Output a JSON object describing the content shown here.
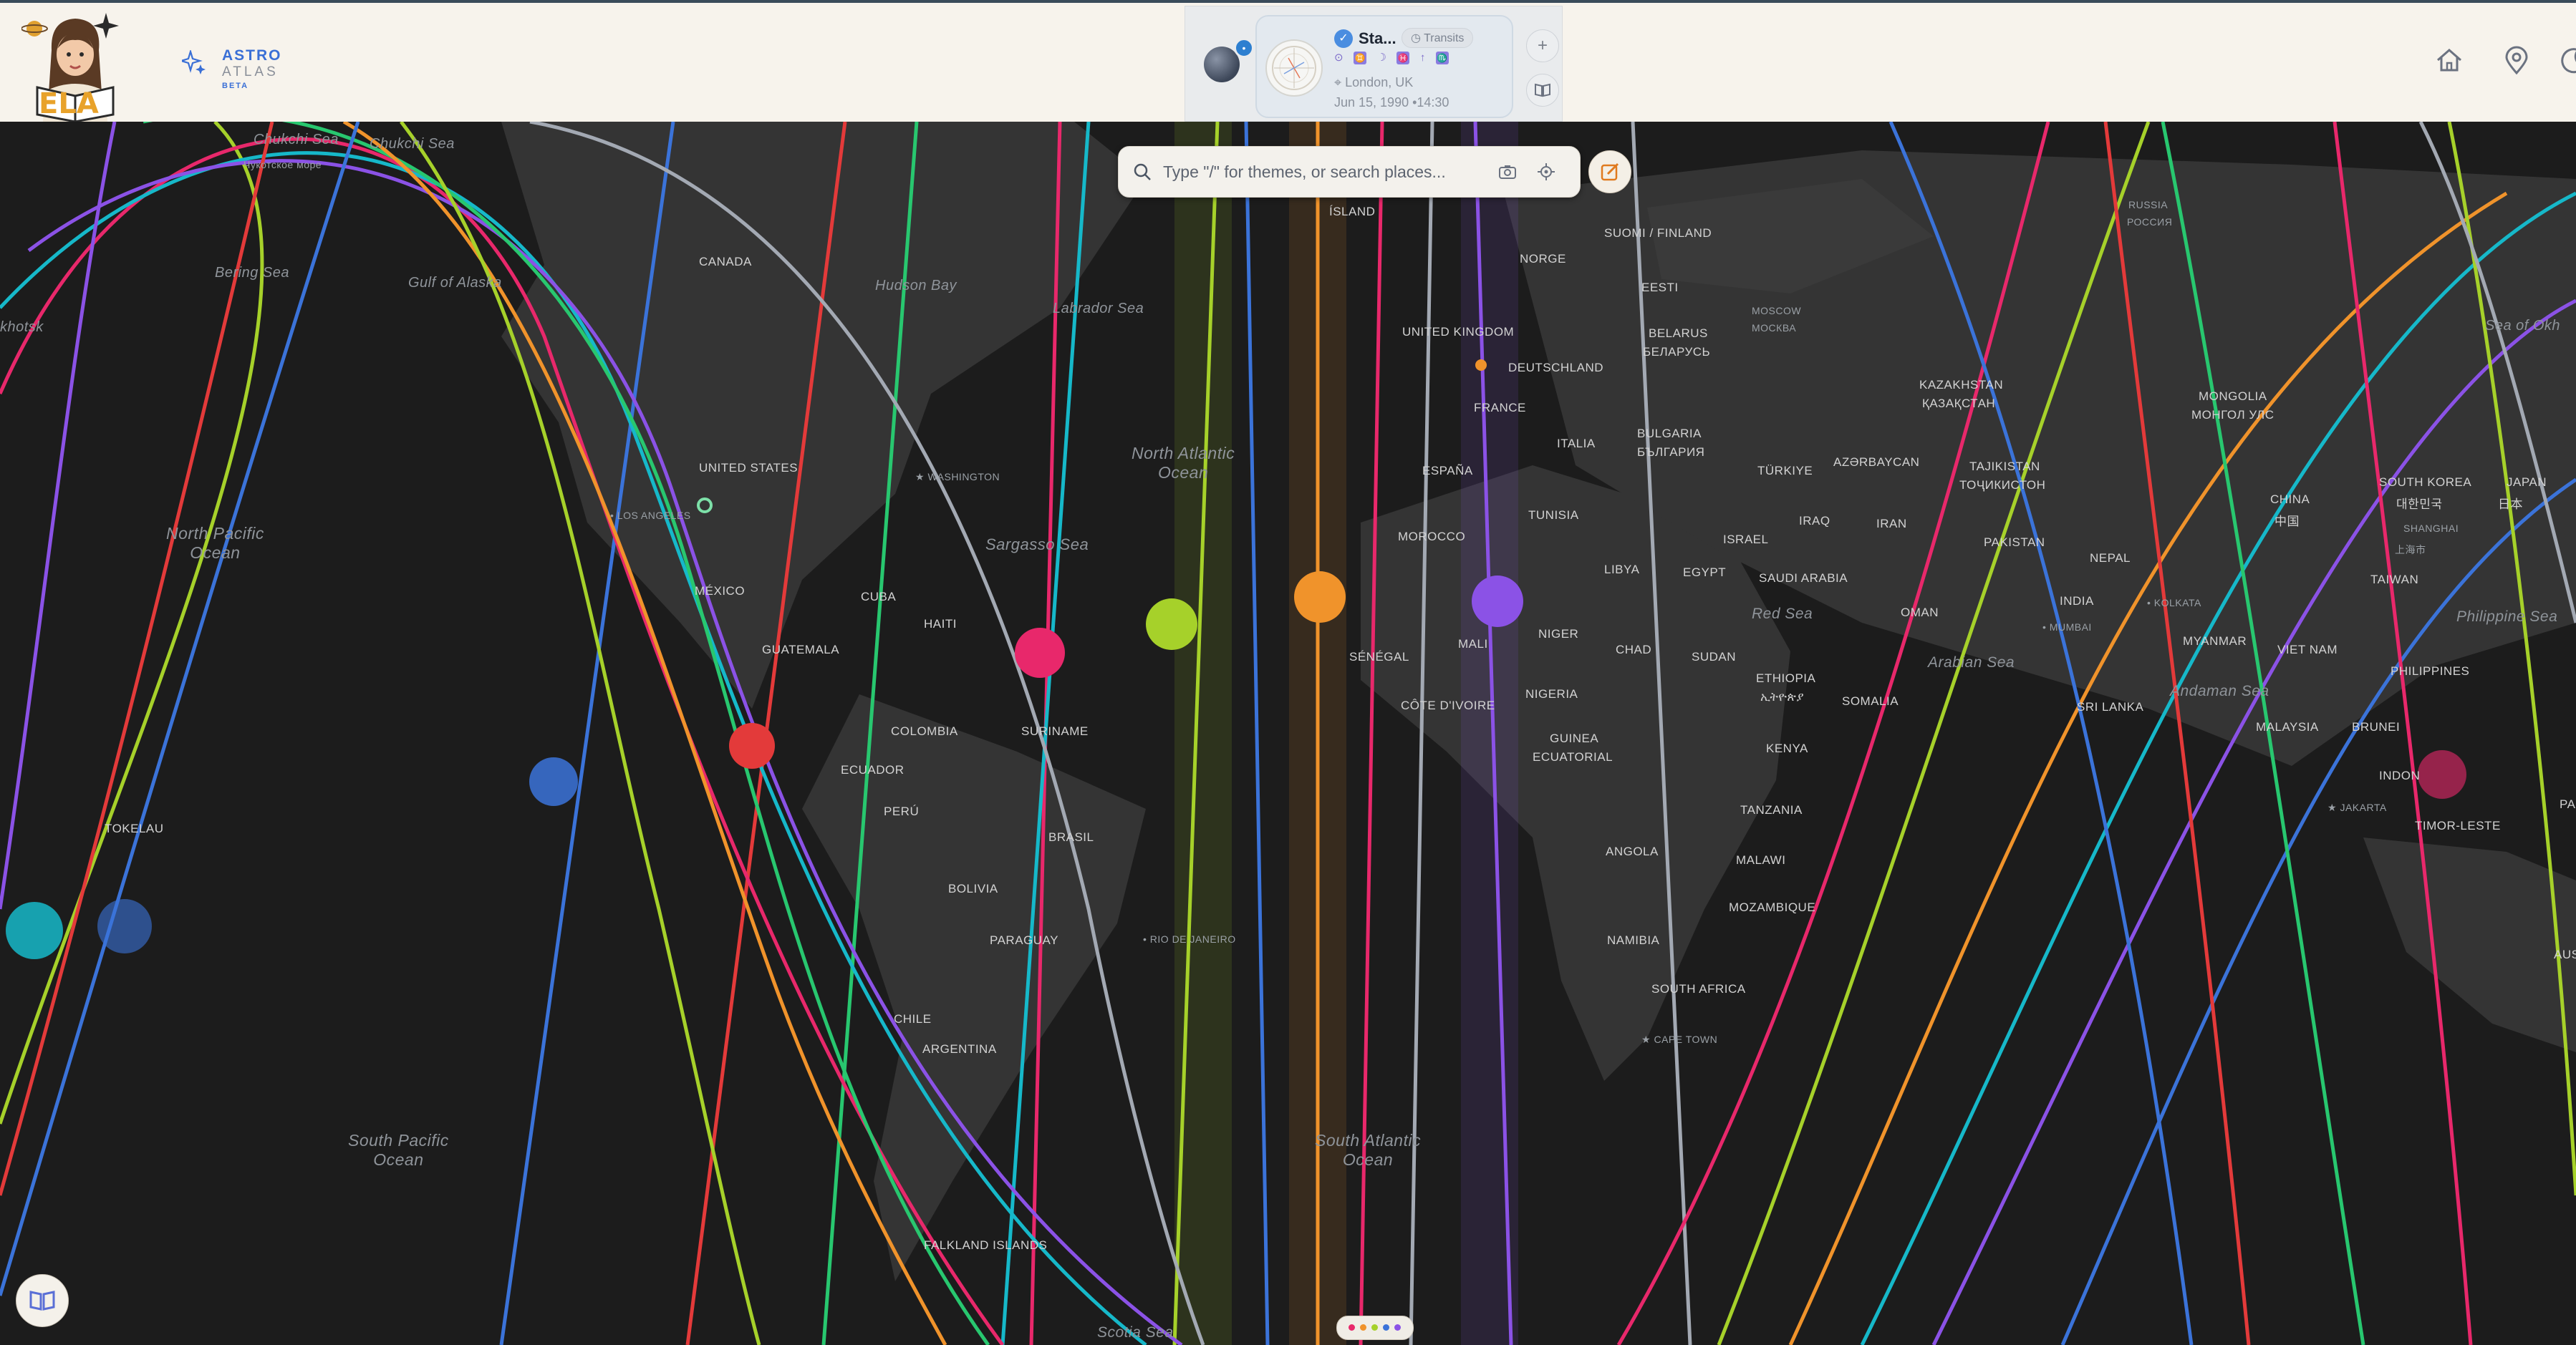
{
  "app": {
    "name_line1": "ASTRO",
    "name_line2": "ATLAS",
    "name_line3": "BETA",
    "logo_text": "ELA"
  },
  "chart_card": {
    "title": "Sta...",
    "mode_label": "Transits",
    "location": "London, UK",
    "datetime": "Jun 15, 1990 •14:30"
  },
  "side_buttons": {
    "add_label": "+"
  },
  "search": {
    "placeholder": "Type \"/\" for themes, or search places..."
  },
  "colors": {
    "header_bg": "#f7f3ec",
    "map_bg": "#1c1c1c",
    "brand_blue": "#3a6fd6",
    "line_colors": [
      "#a6d12a",
      "#f0932b",
      "#e8286b",
      "#3b73d9",
      "#8b52e6",
      "#16b8c9",
      "#e33a3a",
      "#28c76f",
      "#a3a9b3"
    ]
  },
  "icons": [
    "home-icon",
    "map-pin-icon",
    "moon-icon",
    "search-icon",
    "camera-icon",
    "locate-icon",
    "edit-icon",
    "book-icon",
    "check-icon"
  ],
  "map": {
    "labels": {
      "chukchi1": "Chukchi Sea",
      "chukchi_ru": "Чукотское море",
      "chukchi2": "Chukchi Sea",
      "bering": "Bering Sea",
      "alaska": "Gulf of Alaska",
      "okhotsk": "khotsk",
      "canada": "CANADA",
      "hudson": "Hudson Bay",
      "labrador": "Labrador Sea",
      "island": "ÍSLAND",
      "finland": "SUOMI / FINLAND",
      "russia": "RUSSIA",
      "russia_ru": "РОССИЯ",
      "norge": "NORGE",
      "eesti": "EESTI",
      "moscow": "MOSCOW",
      "moscow_ru": "МОСКВА",
      "uk": "UNITED KINGDOM",
      "belarus": "BELARUS",
      "belarus_ru": "БЕЛАРУСЬ",
      "deutschland": "DEUTSCHLAND",
      "kazakhstan": "KAZAKHSTAN",
      "kazakhstan_kz": "ҚАЗАҚСТАН",
      "mongolia": "MONGOLIA",
      "mongolia_mn": "МОНГОЛ УЛС",
      "sea_okhotsk_r": "Sea of Okh",
      "france": "FRANCE",
      "italia": "ITALIA",
      "bulgaria": "BULGARIA",
      "bulgaria_bg": "БЪЛГАРИЯ",
      "turkiye": "TÜRKIYE",
      "azerbaycan": "AZƏRBAYCAN",
      "tajikistan": "TAJIKISTAN",
      "tajikistan_tj": "ТОҶИКИСТОН",
      "us": "UNITED STATES",
      "washington": "WASHINGTON",
      "north_atlantic": "North Atlantic\nOcean",
      "espana": "ESPAÑA",
      "china": "CHINA",
      "china_zh": "中国",
      "south_korea": "SOUTH KOREA",
      "south_korea_ko": "대한민국",
      "japan": "JAPAN",
      "japan_ja": "日本",
      "los_angeles": "LOS ANGELES",
      "north_pacific": "North Pacific\nOcean",
      "sargasso": "Sargasso Sea",
      "morocco": "MOROCCO",
      "tunisia": "TUNISIA",
      "israel": "ISRAEL",
      "iraq": "IRAQ",
      "iran": "IRAN",
      "pakistan": "PAKISTAN",
      "shanghai": "SHANGHAI",
      "shanghai_zh": "上海市",
      "mexico": "MÉXICO",
      "cuba": "CUBA",
      "libya": "LIBYA",
      "egypt": "EGYPT",
      "saudi": "SAUDI ARABIA",
      "nepal": "NEPAL",
      "taiwan": "TAIWAN",
      "haiti": "HAITI",
      "red_sea": "Red Sea",
      "oman": "OMAN",
      "india": "INDIA",
      "kolkata": "KOLKATA",
      "mumbai": "MUMBAI",
      "philippine_sea": "Philippine Sea",
      "guatemala": "GUATEMALA",
      "senegal": "SÉNÉGAL",
      "mali": "MALI",
      "niger": "NIGER",
      "chad": "CHAD",
      "sudan": "SUDAN",
      "myanmar": "MYANMAR",
      "viet_nam": "VIET NAM",
      "cote": "CÔTE D'IVOIRE",
      "arabian_sea": "Arabian Sea",
      "ethiopia": "ETHIOPIA",
      "ethiopia_am": "ኢትዮጵያ",
      "philippines": "PHILIPPINES",
      "nigeria": "NIGERIA",
      "somalia": "SOMALIA",
      "andaman": "Andaman Sea",
      "colombia": "COLOMBIA",
      "suriname": "SURINAME",
      "guinea": "GUINEA",
      "ecuatorial": "ECUATORIAL",
      "sri_lanka": "SRI LANKA",
      "malaysia": "MALAYSIA",
      "brunei": "BRUNEI",
      "ecuador": "ECUADOR",
      "kenya": "KENYA",
      "indon": "INDON",
      "tokelau": "TOKELAU",
      "peru": "PERÚ",
      "jakarta": "JAKARTA",
      "tanzania": "TANZANIA",
      "timor": "TIMOR-LESTE",
      "pa": "PA",
      "brasil": "BRASIL",
      "angola": "ANGOLA",
      "malawi": "MALAWI",
      "bolivia": "BOLIVIA",
      "mozambique": "MOZAMBIQUE",
      "paraguay": "PARAGUAY",
      "rio": "RIO DE JANEIRO",
      "namibia": "NAMIBIA",
      "aus": "AUS",
      "south_africa": "SOUTH AFRICA",
      "chile": "CHILE",
      "argentina": "ARGENTINA",
      "cape_town": "CAPE TOWN",
      "south_pacific": "South Pacific\nOcean",
      "south_atlantic": "South Atlantic\nOcean",
      "falkland": "FALKLAND ISLANDS",
      "scotia": "Scotia Sea"
    }
  }
}
